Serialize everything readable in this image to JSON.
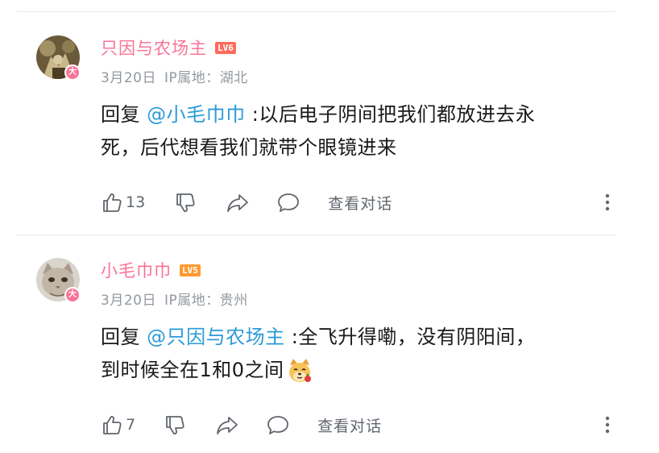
{
  "comments": [
    {
      "username": "只因与农场主",
      "level": "LV6",
      "avatar_badge": "大",
      "date": "3月20日",
      "ip_location": "IP属地：湖北",
      "reply_prefix": "回复 ",
      "mention": "@小毛巾巾",
      "text_line1": " :以后电子阴间把我们都放进去永",
      "text_line2": "死，后代想看我们就带个眼镜进来",
      "like_count": "13",
      "view_conversation": "查看对话"
    },
    {
      "username": "小毛巾巾",
      "level": "LV5",
      "avatar_badge": "大",
      "date": "3月20日",
      "ip_location": "IP属地：贵州",
      "reply_prefix": "回复 ",
      "mention": "@只因与农场主",
      "text_line1": " :全飞升得嘞，没有阴阳间，",
      "text_line2": "到时候全在1和0之间",
      "emoji": "dog-emoji",
      "like_count": "7",
      "view_conversation": "查看对话"
    }
  ],
  "colors": {
    "username": "#fb7299",
    "mention": "#2b9bd8",
    "meta": "#9499a0",
    "lv6": "#ff6a5a",
    "lv5": "#ff9a31"
  },
  "icons": {
    "like": "thumb-up-icon",
    "dislike": "thumb-down-icon",
    "share": "share-icon",
    "reply": "comment-bubble-icon",
    "more": "more-vertical-icon"
  }
}
